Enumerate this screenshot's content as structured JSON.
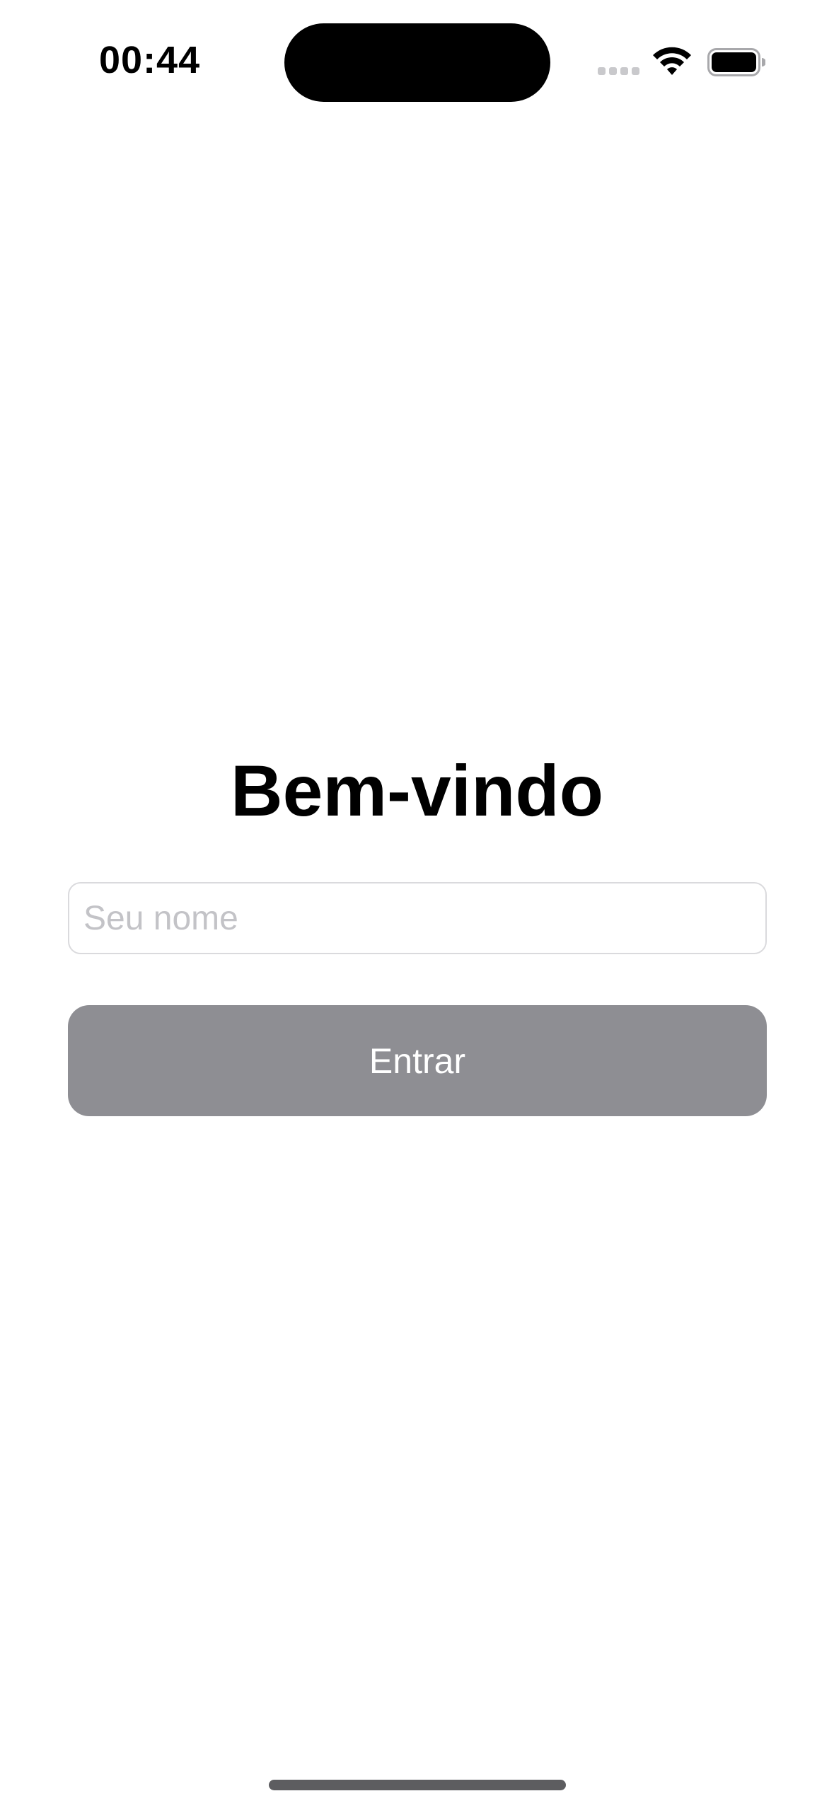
{
  "status_bar": {
    "time": "00:44",
    "icons": [
      "signal-icon",
      "wifi-icon",
      "battery-icon"
    ]
  },
  "main": {
    "title": "Bem-vindo",
    "name_input": {
      "value": "",
      "placeholder": "Seu nome"
    },
    "enter_button_label": "Entrar"
  },
  "colors": {
    "button_background": "#8e8e93",
    "button_text": "#ffffff",
    "placeholder": "#c3c3c7",
    "input_border": "#dadadd"
  }
}
